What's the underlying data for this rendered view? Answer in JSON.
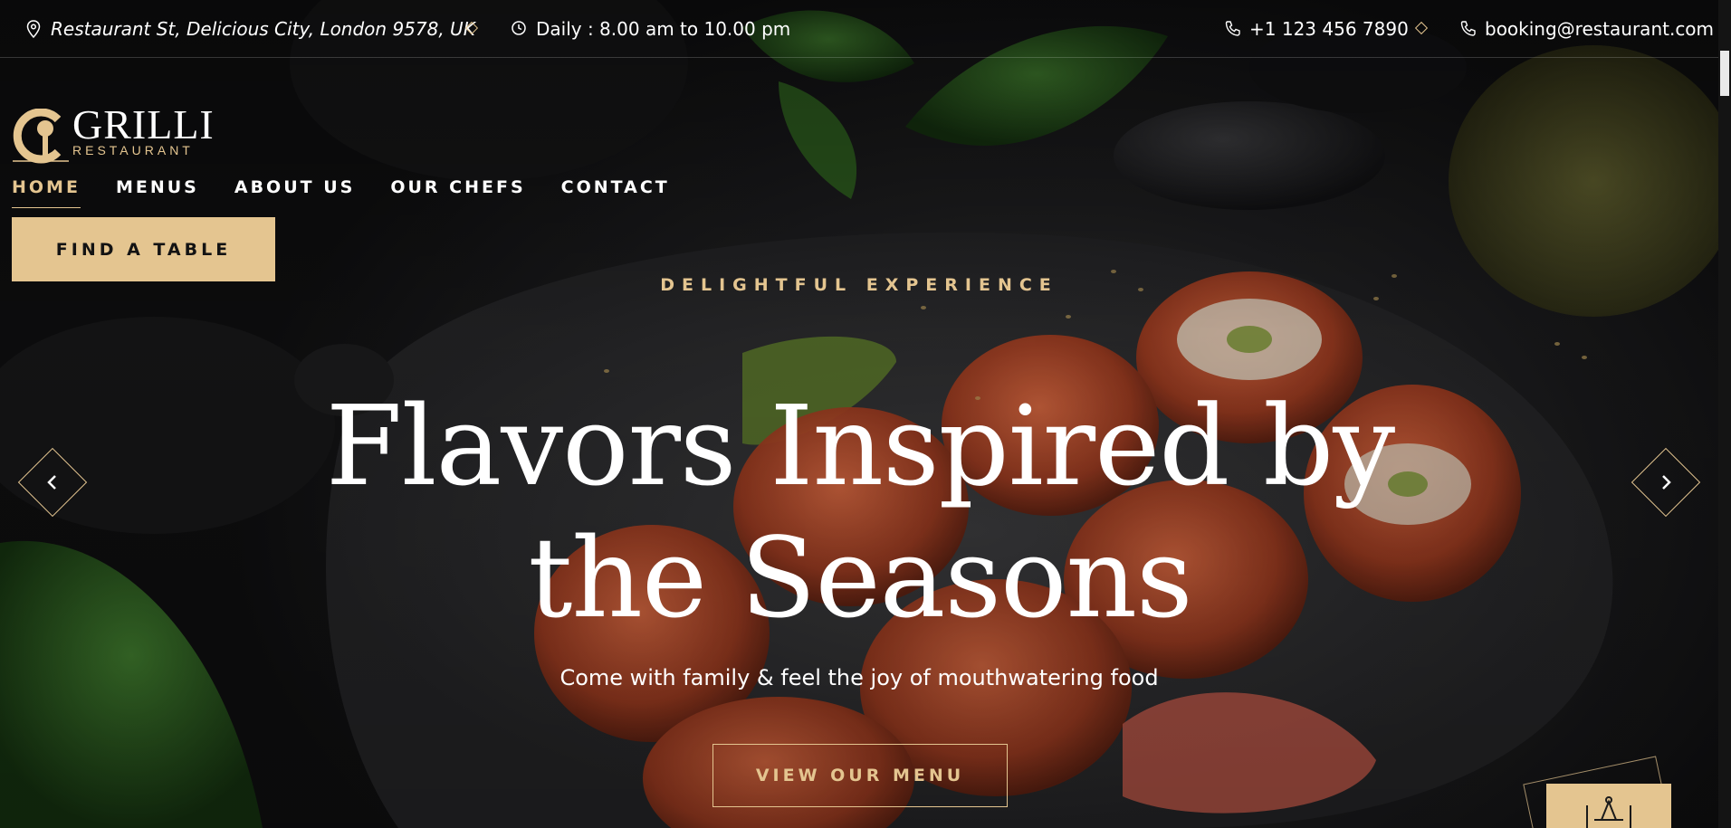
{
  "topbar": {
    "address": "Restaurant St, Delicious City, London 9578, UK",
    "hours": "Daily : 8.00 am to 10.00 pm",
    "phone": "+1 123 456 7890",
    "email": "booking@restaurant.com"
  },
  "logo": {
    "name": "GRILLI",
    "sub": "RESTAURANT"
  },
  "nav": {
    "items": [
      {
        "label": "HOME"
      },
      {
        "label": "MENUS"
      },
      {
        "label": "ABOUT US"
      },
      {
        "label": "OUR CHEFS"
      },
      {
        "label": "CONTACT"
      }
    ],
    "active_index": 0
  },
  "cta": {
    "find_table": "FIND A TABLE"
  },
  "hero": {
    "eyebrow": "DELIGHTFUL EXPERIENCE",
    "headline_line1": "Flavors Inspired by",
    "headline_line2": "the Seasons",
    "tagline": "Come with family & feel the joy of mouthwatering food",
    "menu_button": "VIEW OUR MENU"
  },
  "colors": {
    "accent": "#e4c590",
    "text": "#ffffff",
    "background": "#0e0e0f"
  },
  "icons": {
    "address": "location-pin-icon",
    "hours": "clock-icon",
    "phone": "phone-icon",
    "email": "mail-icon",
    "prev": "chevron-left-icon",
    "next": "chevron-right-icon",
    "badge": "table-icon"
  }
}
